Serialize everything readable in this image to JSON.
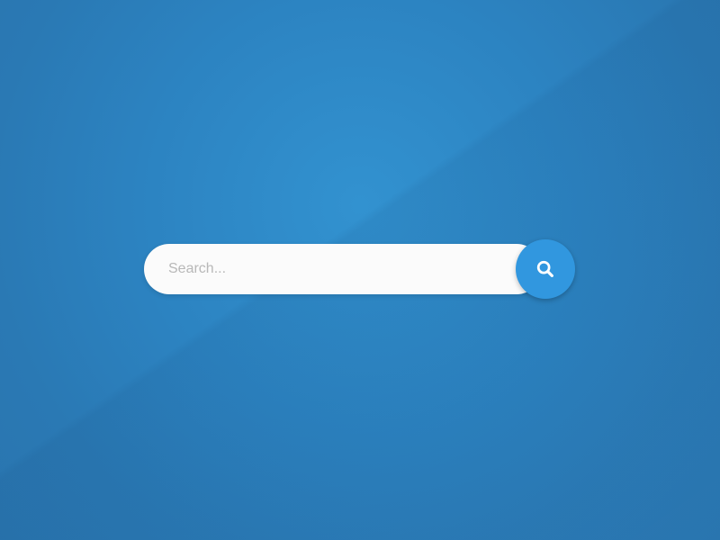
{
  "search": {
    "placeholder": "Search...",
    "value": ""
  },
  "icons": {
    "search_button": "search-icon"
  },
  "colors": {
    "background": "#2c83c1",
    "button": "#3197df",
    "field": "#fbfbfb",
    "placeholder": "#b8b8b8"
  }
}
